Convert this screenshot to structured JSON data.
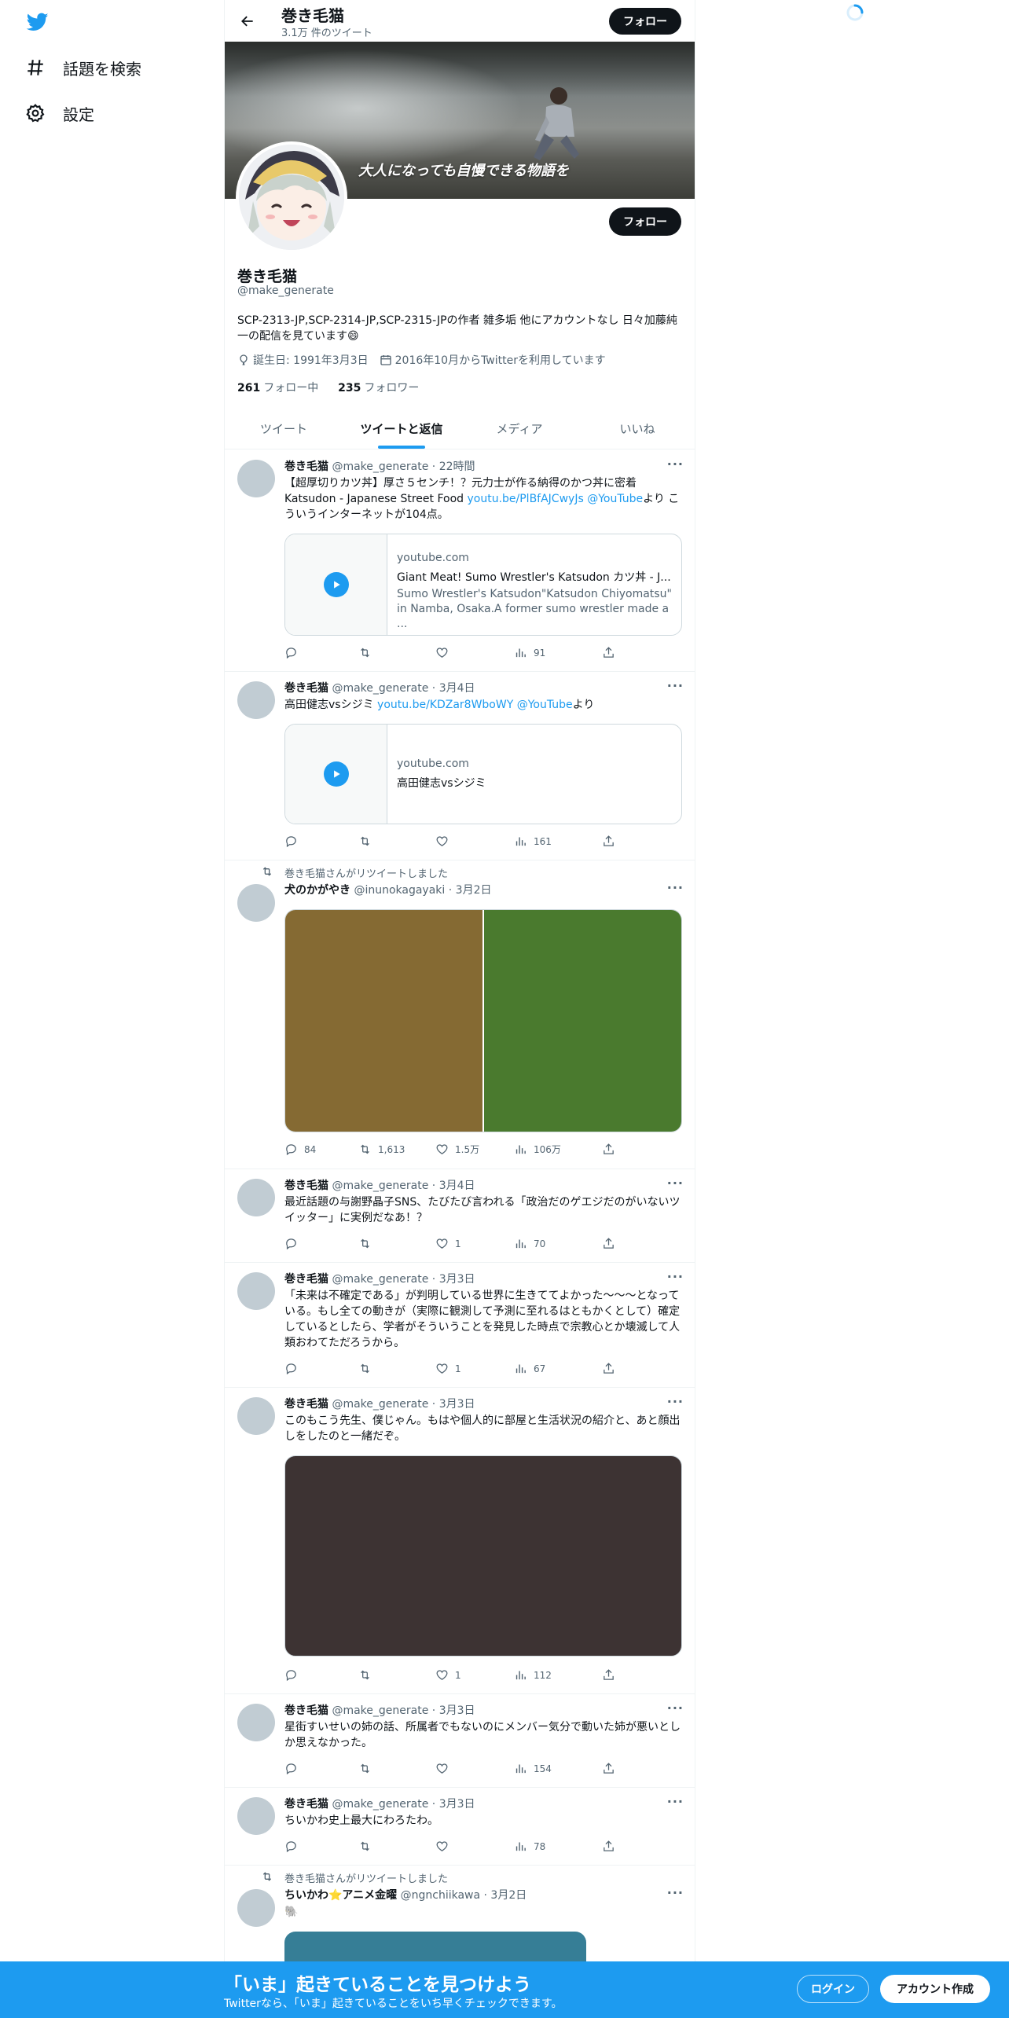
{
  "nav": {
    "explore_label": "話題を検索",
    "settings_label": "設定"
  },
  "header": {
    "name": "巻き毛猫",
    "tweet_count": "3.1万 件のツイート",
    "follow_label": "フォロー"
  },
  "banner": {
    "text": "大人になっても自慢できる物語を"
  },
  "profile": {
    "display_name": "巻き毛猫",
    "handle": "@make_generate",
    "bio": "SCP-2313-JP,SCP-2314-JP,SCP-2315-JPの作者 雑多垢 他にアカウントなし 日々加藤純一の配信を見ています😄",
    "birthday": "誕生日: 1991年3月3日",
    "joined": "2016年10月からTwitterを利用しています",
    "following_count": "261",
    "following_label": "フォロー中",
    "followers_count": "235",
    "followers_label": "フォロワー",
    "follow_label": "フォロー"
  },
  "tabs": [
    "ツイート",
    "ツイートと返信",
    "メディア",
    "いいね"
  ],
  "tweets": [
    {
      "name": "巻き毛猫",
      "handle": "@make_generate",
      "time": "22時間",
      "text_before": "【超厚切りカツ丼】厚さ５センチ！？元力士が作る納得のかつ丼に密着 Katsudon - Japanese Street Food ",
      "link": "youtu.be/PlBfAJCwyJs",
      "mention": "@YouTube",
      "text_after": "より こういうインターネットが104点。",
      "card_domain": "youtube.com",
      "card_title": "Giant Meat! Sumo Wrestler's Katsudon カツ丼 - J...",
      "card_desc": "Sumo Wrestler's Katsudon\"Katsudon Chiyomatsu\" in Namba, Osaka.A former sumo wrestler made a ...",
      "replies": "",
      "retweets": "",
      "likes": "",
      "views": "91"
    },
    {
      "name": "巻き毛猫",
      "handle": "@make_generate",
      "time": "3月4日",
      "text_before": "高田健志vsシジミ ",
      "link": "youtu.be/KDZar8WboWY",
      "mention": "@YouTube",
      "text_after": "より",
      "card_domain": "youtube.com",
      "card_title": "高田健志vsシジミ",
      "replies": "",
      "retweets": "",
      "likes": "",
      "views": "161"
    },
    {
      "retweet_label": "巻き毛猫さんがリツイートしました",
      "name": "犬のかがやき",
      "handle": "@inunokagayaki",
      "time": "3月2日",
      "media_colors": [
        "#856a33",
        "#4a7a2e"
      ],
      "replies": "84",
      "retweets": "1,613",
      "likes": "1.5万",
      "views": "106万"
    },
    {
      "name": "巻き毛猫",
      "handle": "@make_generate",
      "time": "3月4日",
      "text": "最近話題の与謝野晶子SNS、たびたび言われる「政治だのゲエジだのがいないツイッター」に実例だなあ！？",
      "replies": "",
      "retweets": "",
      "likes": "1",
      "views": "70"
    },
    {
      "name": "巻き毛猫",
      "handle": "@make_generate",
      "time": "3月3日",
      "text": "「未来は不確定である」が判明している世界に生きててよかった～～～となっている。もし全ての動きが（実際に観測して予測に至れるはともかくとして）確定しているとしたら、学者がそういうことを発見した時点で宗教心とか壊滅して人類おわてただろうから。",
      "replies": "",
      "retweets": "",
      "likes": "1",
      "views": "67"
    },
    {
      "name": "巻き毛猫",
      "handle": "@make_generate",
      "time": "3月3日",
      "text": "このもこう先生、僕じゃん。もはや個人的に部屋と生活状況の紹介と、あと顔出しをしたのと一緒だぞ。",
      "media_color": "#3d3333",
      "replies": "",
      "retweets": "",
      "likes": "1",
      "views": "112"
    },
    {
      "name": "巻き毛猫",
      "handle": "@make_generate",
      "time": "3月3日",
      "text": "星街すいせいの姉の話、所属者でもないのにメンバー気分で動いた姉が悪いとしか思えなかった。",
      "replies": "",
      "retweets": "",
      "likes": "",
      "views": "154"
    },
    {
      "name": "巻き毛猫",
      "handle": "@make_generate",
      "time": "3月3日",
      "text": "ちいかわ史上最大にわろたわ。",
      "replies": "",
      "retweets": "",
      "likes": "",
      "views": "78"
    },
    {
      "retweet_label": "巻き毛猫さんがリツイートしました",
      "name": "ちいかわ⭐アニメ金曜",
      "handle": "@ngnchiikawa",
      "time": "3月2日",
      "text": "🐘",
      "media_color": "#367e96"
    }
  ],
  "bottom_bar": {
    "title": "「いま」起きていることを見つけよう",
    "subtitle": "Twitterなら、「いま」起きていることをいち早くチェックできます。",
    "login_label": "ログイン",
    "signup_label": "アカウント作成"
  },
  "colors": {
    "accent": "#1d9bf0",
    "text": "#0f1419",
    "muted": "#536471"
  }
}
